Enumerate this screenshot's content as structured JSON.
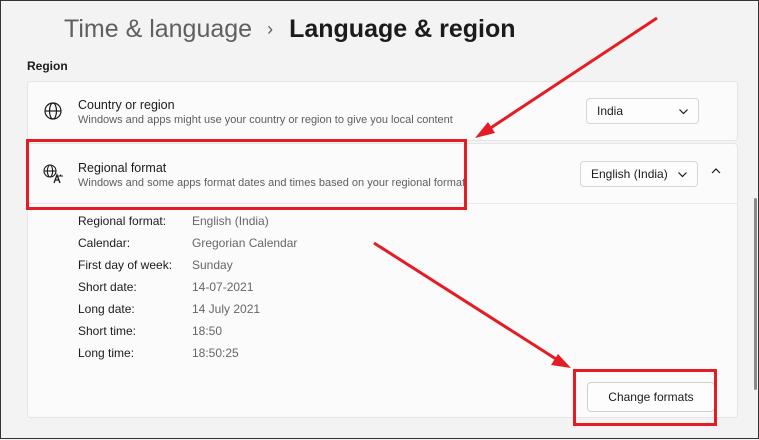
{
  "breadcrumb": {
    "parent": "Time & language",
    "separator": "›",
    "current": "Language & region"
  },
  "section": {
    "label": "Region"
  },
  "country": {
    "icon": "globe-icon",
    "title": "Country or region",
    "description": "Windows and apps might use your country or region to give you local content",
    "selected": "India"
  },
  "regional": {
    "icon": "language-format-icon",
    "title": "Regional format",
    "description": "Windows and some apps format dates and times based on your regional format",
    "selected": "English (India)",
    "expanded": true,
    "details": [
      {
        "key": "Regional format:",
        "value": "English (India)"
      },
      {
        "key": "Calendar:",
        "value": "Gregorian Calendar"
      },
      {
        "key": "First day of week:",
        "value": "Sunday"
      },
      {
        "key": "Short date:",
        "value": "14-07-2021"
      },
      {
        "key": "Long date:",
        "value": "14 July 2021"
      },
      {
        "key": "Short time:",
        "value": "18:50"
      },
      {
        "key": "Long time:",
        "value": "18:50:25"
      }
    ],
    "change_button": "Change formats"
  },
  "annotations": {
    "color": "#e51c23"
  }
}
